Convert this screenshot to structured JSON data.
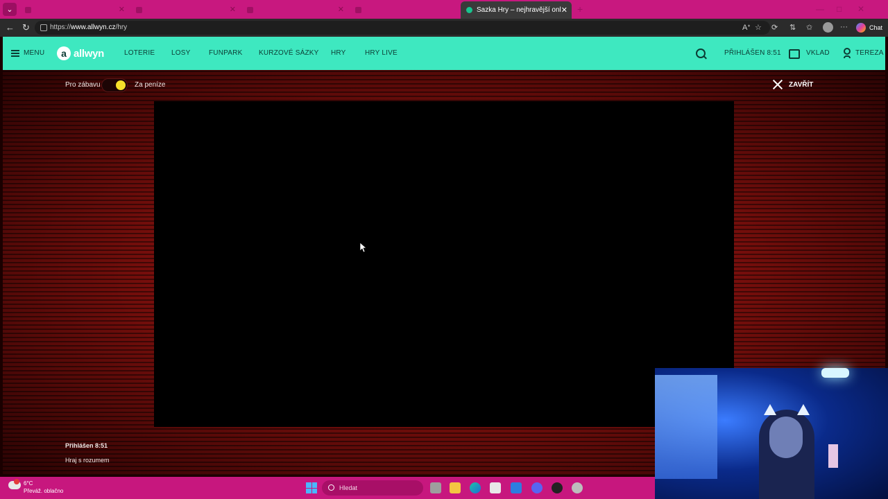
{
  "browser": {
    "active_tab_title": "Sazka Hry – nejhravější online casino",
    "url_prefix": "https://",
    "url_domain": "www.allwyn.cz",
    "url_path": "/hry",
    "chat_label": "Chat"
  },
  "site": {
    "brand": "allwyn",
    "brand_mark": "a",
    "menu_label": "MENU",
    "nav": [
      "LOTERIE",
      "LOSY",
      "FUNPARK",
      "KURZOVÉ SÁZKY",
      "HRY",
      "HRY LIVE"
    ],
    "session_label": "PŘIHLÁŠEN 8:51",
    "deposit_label": "VKLAD",
    "user_label": "TEREZA"
  },
  "game_page": {
    "mode_left": "Pro zábavu",
    "mode_right": "Za peníze",
    "mode_selected": "Za peníze",
    "close_label": "ZAVŘÍT",
    "footer_session": "Přihlášen 8:51",
    "footer_responsible": "Hraj s rozumem"
  },
  "taskbar": {
    "weather_temp": "6°C",
    "weather_desc": "Převáž. oblačno",
    "search_placeholder": "Hledat"
  },
  "colors": {
    "tabbar": "#c8187f",
    "header": "#3ee8c0",
    "toggle_knob": "#f5e02a"
  }
}
